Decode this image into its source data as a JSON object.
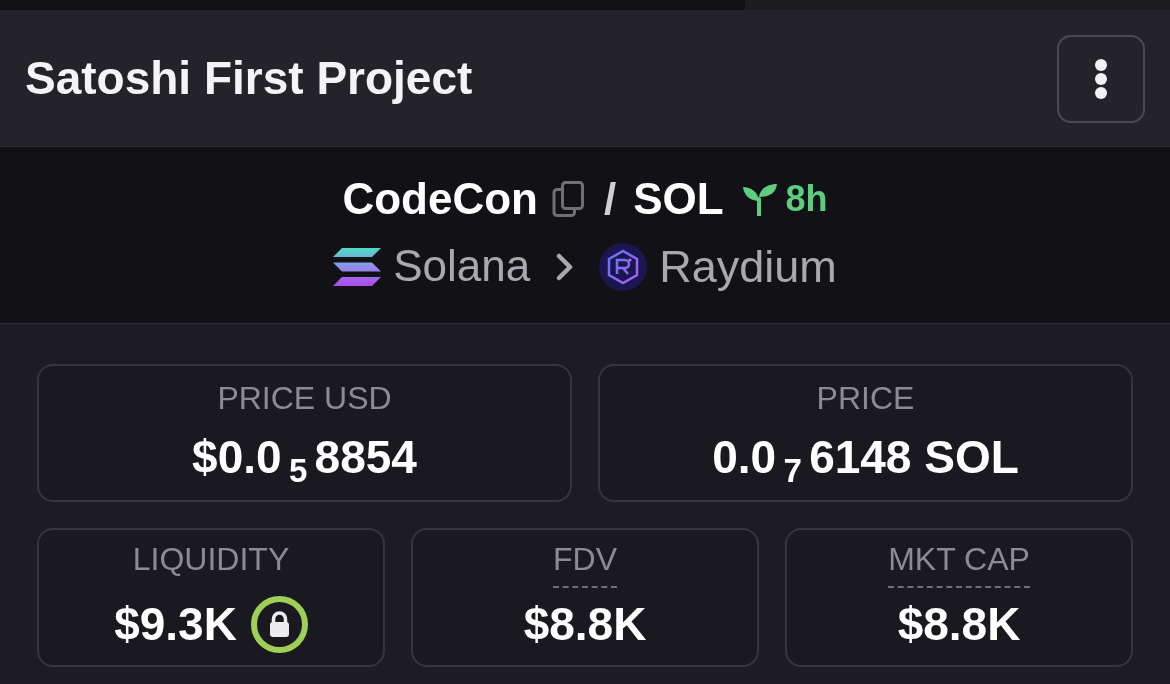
{
  "header": {
    "title": "Satoshi First Project"
  },
  "pair": {
    "base": "CodeCon",
    "separator": "/",
    "quote": "SOL",
    "age": "8h",
    "chain": "Solana",
    "dex": "Raydium"
  },
  "price_cards": [
    {
      "label": "PRICE USD",
      "value": "$0.0$_{5}$8854"
    },
    {
      "label": "PRICE",
      "value": "0.0$_{7}$6148 SOL"
    }
  ],
  "stat_cards": [
    {
      "label": "LIQUIDITY",
      "value": "$9.3K",
      "underlined": false,
      "locked": true
    },
    {
      "label": "FDV",
      "value": "$8.8K",
      "underlined": true,
      "locked": false
    },
    {
      "label": "MKT CAP",
      "value": "$8.8K",
      "underlined": true,
      "locked": false
    }
  ]
}
